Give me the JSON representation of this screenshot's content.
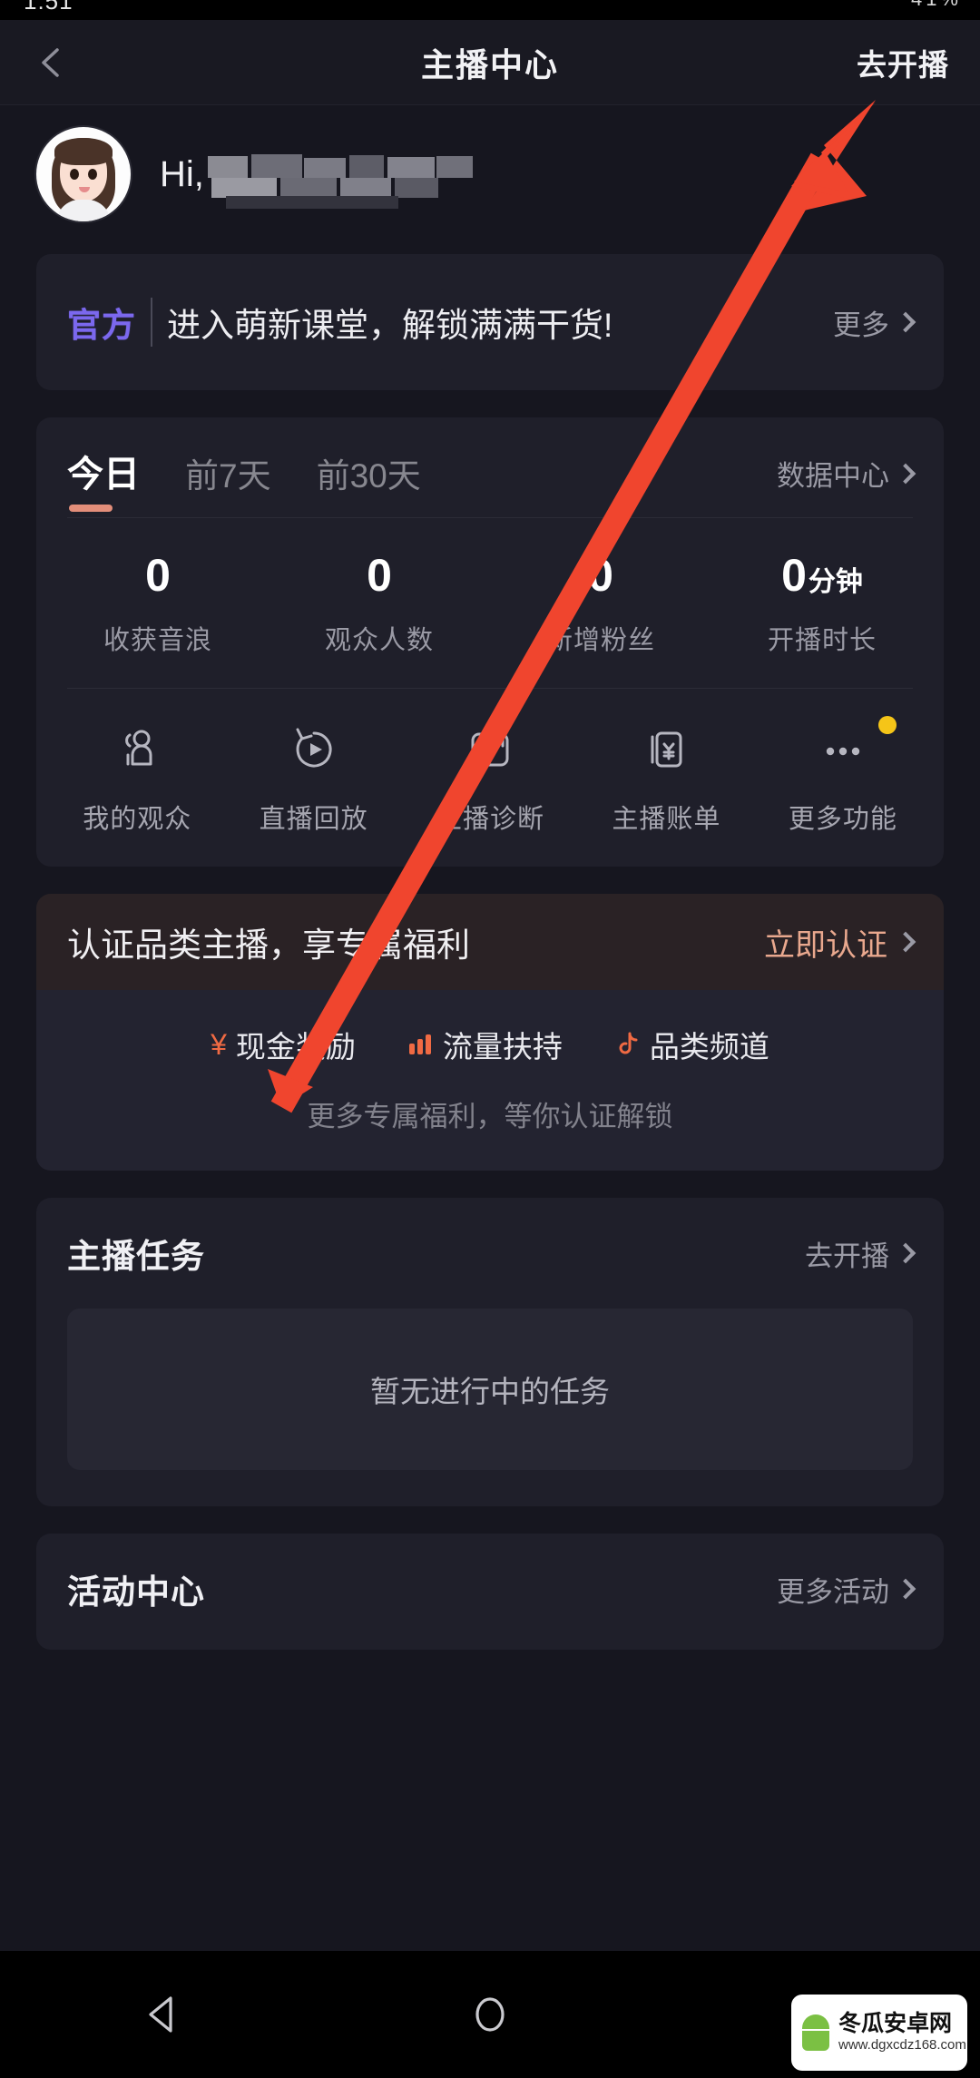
{
  "statusbar": {
    "time_partial": "1:51",
    "right_partial": "41%"
  },
  "navbar": {
    "back_icon": "chevron-left-icon",
    "title": "主播中心",
    "go_live": "去开播"
  },
  "greeting": {
    "hi": "Hi,",
    "username_redacted": ""
  },
  "banner": {
    "tag": "官方",
    "text": "进入萌新课堂，解锁满满干货!",
    "more": "更多"
  },
  "data_card": {
    "tabs": [
      {
        "label": "今日",
        "active": true
      },
      {
        "label": "前7天",
        "active": false
      },
      {
        "label": "前30天",
        "active": false
      }
    ],
    "data_center": "数据中心",
    "stats": [
      {
        "value": "0",
        "unit": "",
        "label": "收获音浪"
      },
      {
        "value": "0",
        "unit": "",
        "label": "观众人数"
      },
      {
        "value": "0",
        "unit": "",
        "label": "新增粉丝"
      },
      {
        "value": "0",
        "unit": "分钟",
        "label": "开播时长"
      }
    ],
    "quick_actions": [
      {
        "label": "我的观众",
        "icon": "people-icon",
        "badge": false
      },
      {
        "label": "直播回放",
        "icon": "replay-play-icon",
        "badge": false
      },
      {
        "label": "主播诊断",
        "icon": "chart-trend-icon",
        "badge": false
      },
      {
        "label": "主播账单",
        "icon": "bill-yuan-icon",
        "badge": false
      },
      {
        "label": "更多功能",
        "icon": "more-dots-icon",
        "badge": true
      }
    ]
  },
  "cert_card": {
    "title": "认证品类主播，享专属福利",
    "cta": "立即认证",
    "benefits": [
      {
        "label": "现金奖励",
        "icon": "yuan-icon"
      },
      {
        "label": "流量扶持",
        "icon": "bars-icon"
      },
      {
        "label": "品类频道",
        "icon": "music-note-icon"
      }
    ],
    "subtitle": "更多专属福利，等你认证解锁"
  },
  "task_card": {
    "title": "主播任务",
    "action": "去开播",
    "empty_text": "暂无进行中的任务"
  },
  "activity_card": {
    "title": "活动中心",
    "action": "更多活动"
  },
  "android_nav": {
    "back": "back-triangle-icon",
    "home": "home-circle-icon",
    "recents": "recents-square-icon"
  },
  "watermark": {
    "name": "冬瓜安卓网",
    "url": "www.dgxcdz168.com"
  },
  "annotation": {
    "type": "red-arrow",
    "points_to": "去开播"
  },
  "colors": {
    "page_bg": "#16161F",
    "card_bg": "#1F1F2A",
    "accent_official": "#7B68EE",
    "accent_tab": "#E38E7A",
    "accent_cta": "#E9A88E",
    "accent_benefit": "#F06A43",
    "badge": "#F5C518",
    "arrow": "#F0452E"
  }
}
